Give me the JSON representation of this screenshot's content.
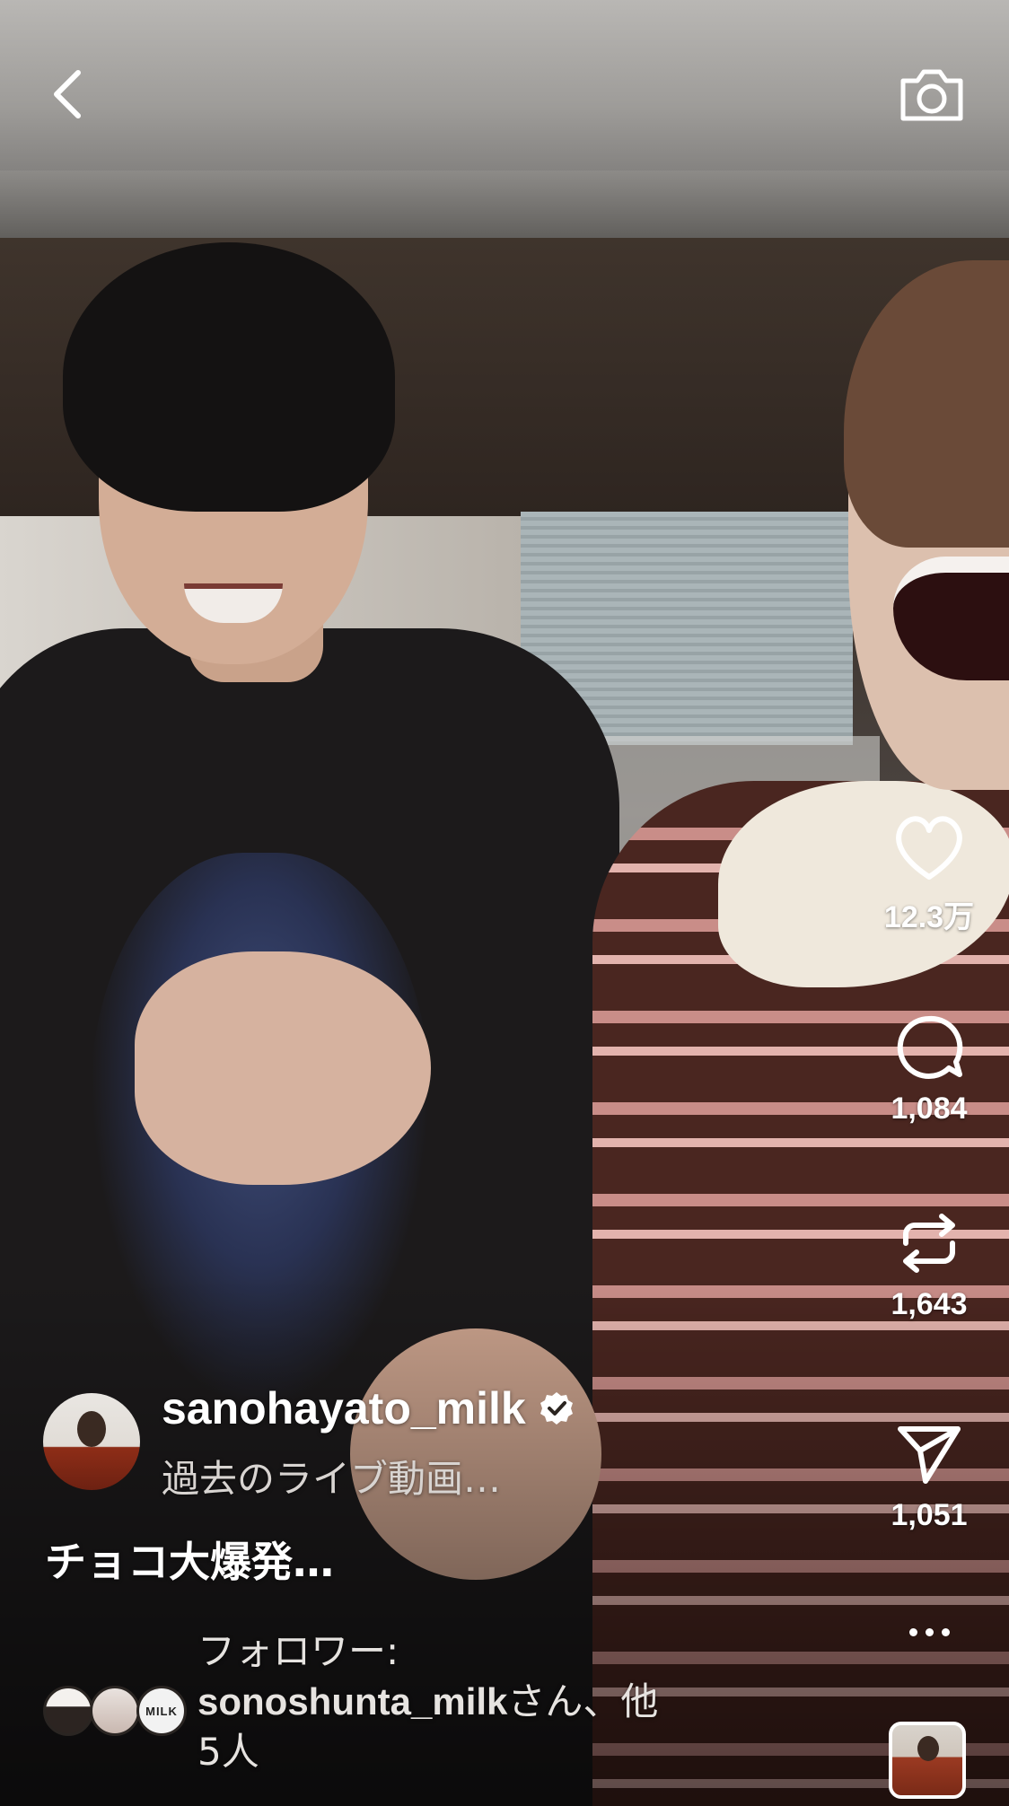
{
  "post": {
    "username": "sanohayato_milk",
    "subtitle": "過去のライブ動画…",
    "caption": "チョコ大爆発…"
  },
  "actions": {
    "likes": "12.3万",
    "comments": "1,084",
    "reposts": "1,643",
    "shares": "1,051"
  },
  "followers": {
    "prefix": "フォロワー:",
    "name": "sonoshunta_milk",
    "suffix": "さん、他",
    "others": "5人"
  },
  "mini_avatar_text": "MILK",
  "icons": {
    "back": "chevron-left-icon",
    "camera": "camera-icon",
    "like": "heart-icon",
    "comment": "comment-icon",
    "repost": "repost-icon",
    "share": "send-icon",
    "more": "more-icon",
    "verified": "verified-badge-icon"
  },
  "colors": {
    "text": "#ffffff",
    "subtext": "#d8d4d1"
  }
}
